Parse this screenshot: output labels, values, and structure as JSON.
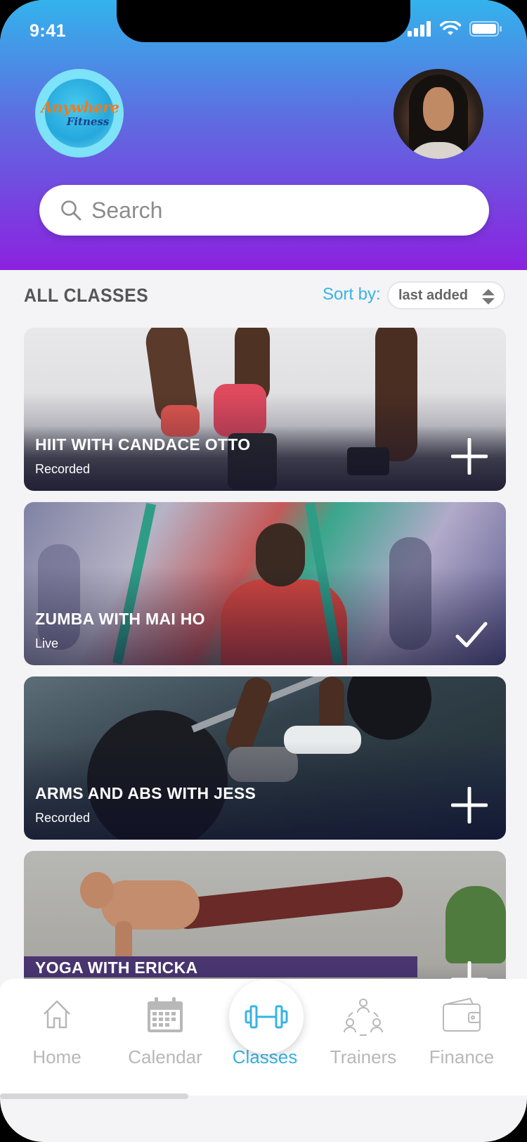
{
  "status": {
    "time": "9:41"
  },
  "brand": {
    "logo_line1": "Anywhere",
    "logo_line2": "Fitness"
  },
  "search": {
    "placeholder": "Search"
  },
  "section": {
    "title": "ALL CLASSES",
    "sort_label": "Sort by:",
    "sort_value": "last added"
  },
  "classes": [
    {
      "title": "HIIT WITH CANDACE OTTO",
      "type": "Recorded",
      "action": "add"
    },
    {
      "title": "ZUMBA WITH MAI HO",
      "type": "Live",
      "action": "added"
    },
    {
      "title": "ARMS AND ABS WITH JESS",
      "type": "Recorded",
      "action": "add"
    },
    {
      "title": "YOGA WITH ERICKA",
      "type": "",
      "action": "add"
    }
  ],
  "nav": {
    "home": "Home",
    "calendar": "Calendar",
    "classes": "Classes",
    "trainers": "Trainers",
    "finance": "Finance"
  },
  "colors": {
    "accent": "#37b3e6",
    "gradient_top": "#33b3ec",
    "gradient_bottom": "#8b22e0",
    "inactive": "#b8b8b8"
  }
}
